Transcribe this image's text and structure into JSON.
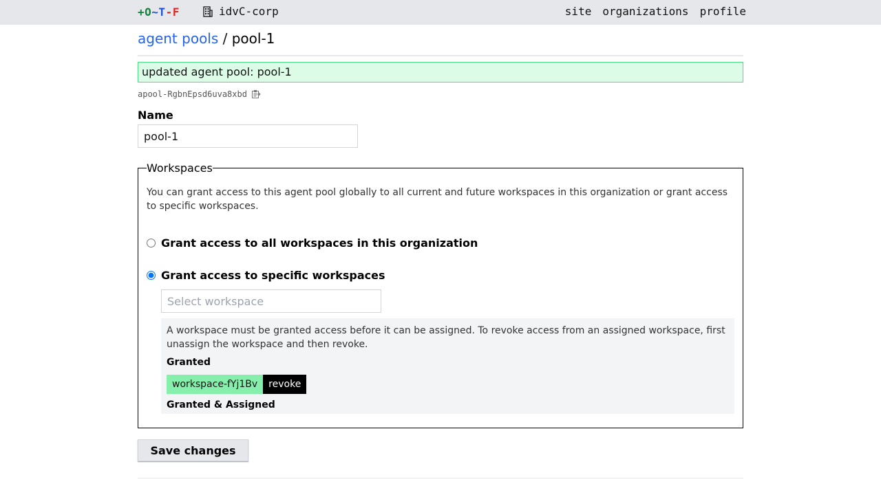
{
  "topbar": {
    "logo": {
      "p1": "+",
      "p2": "O",
      "p3": "~",
      "p4": "T",
      "p5": "-",
      "p6": "F"
    },
    "org_name": "idvC-corp",
    "nav": [
      "site",
      "organizations",
      "profile"
    ]
  },
  "breadcrumb": {
    "parent": "agent pools",
    "separator": " / ",
    "current": "pool-1"
  },
  "flash": {
    "message": "updated agent pool: pool-1",
    "color": "#dcfce7"
  },
  "resource_id": "apool-RgbnEpsd6uva8xbd",
  "name_field": {
    "label": "Name",
    "value": "pool-1"
  },
  "workspaces": {
    "legend": "Workspaces",
    "description": "You can grant access to this agent pool globally to all current and future workspaces in this organization or grant access to specific workspaces.",
    "option_all": {
      "label": "Grant access to all workspaces in this organization",
      "checked": false
    },
    "option_specific": {
      "label": "Grant access to specific workspaces",
      "checked": true
    },
    "select_placeholder": "Select workspace",
    "info": "A workspace must be granted access before it can be assigned. To revoke access from an assigned workspace, first unassign the workspace and then revoke.",
    "granted_header": "Granted",
    "granted": [
      {
        "name": "workspace-fYj1Bv",
        "action": "revoke"
      }
    ],
    "granted_assigned_header": "Granted & Assigned"
  },
  "save_button": "Save changes"
}
